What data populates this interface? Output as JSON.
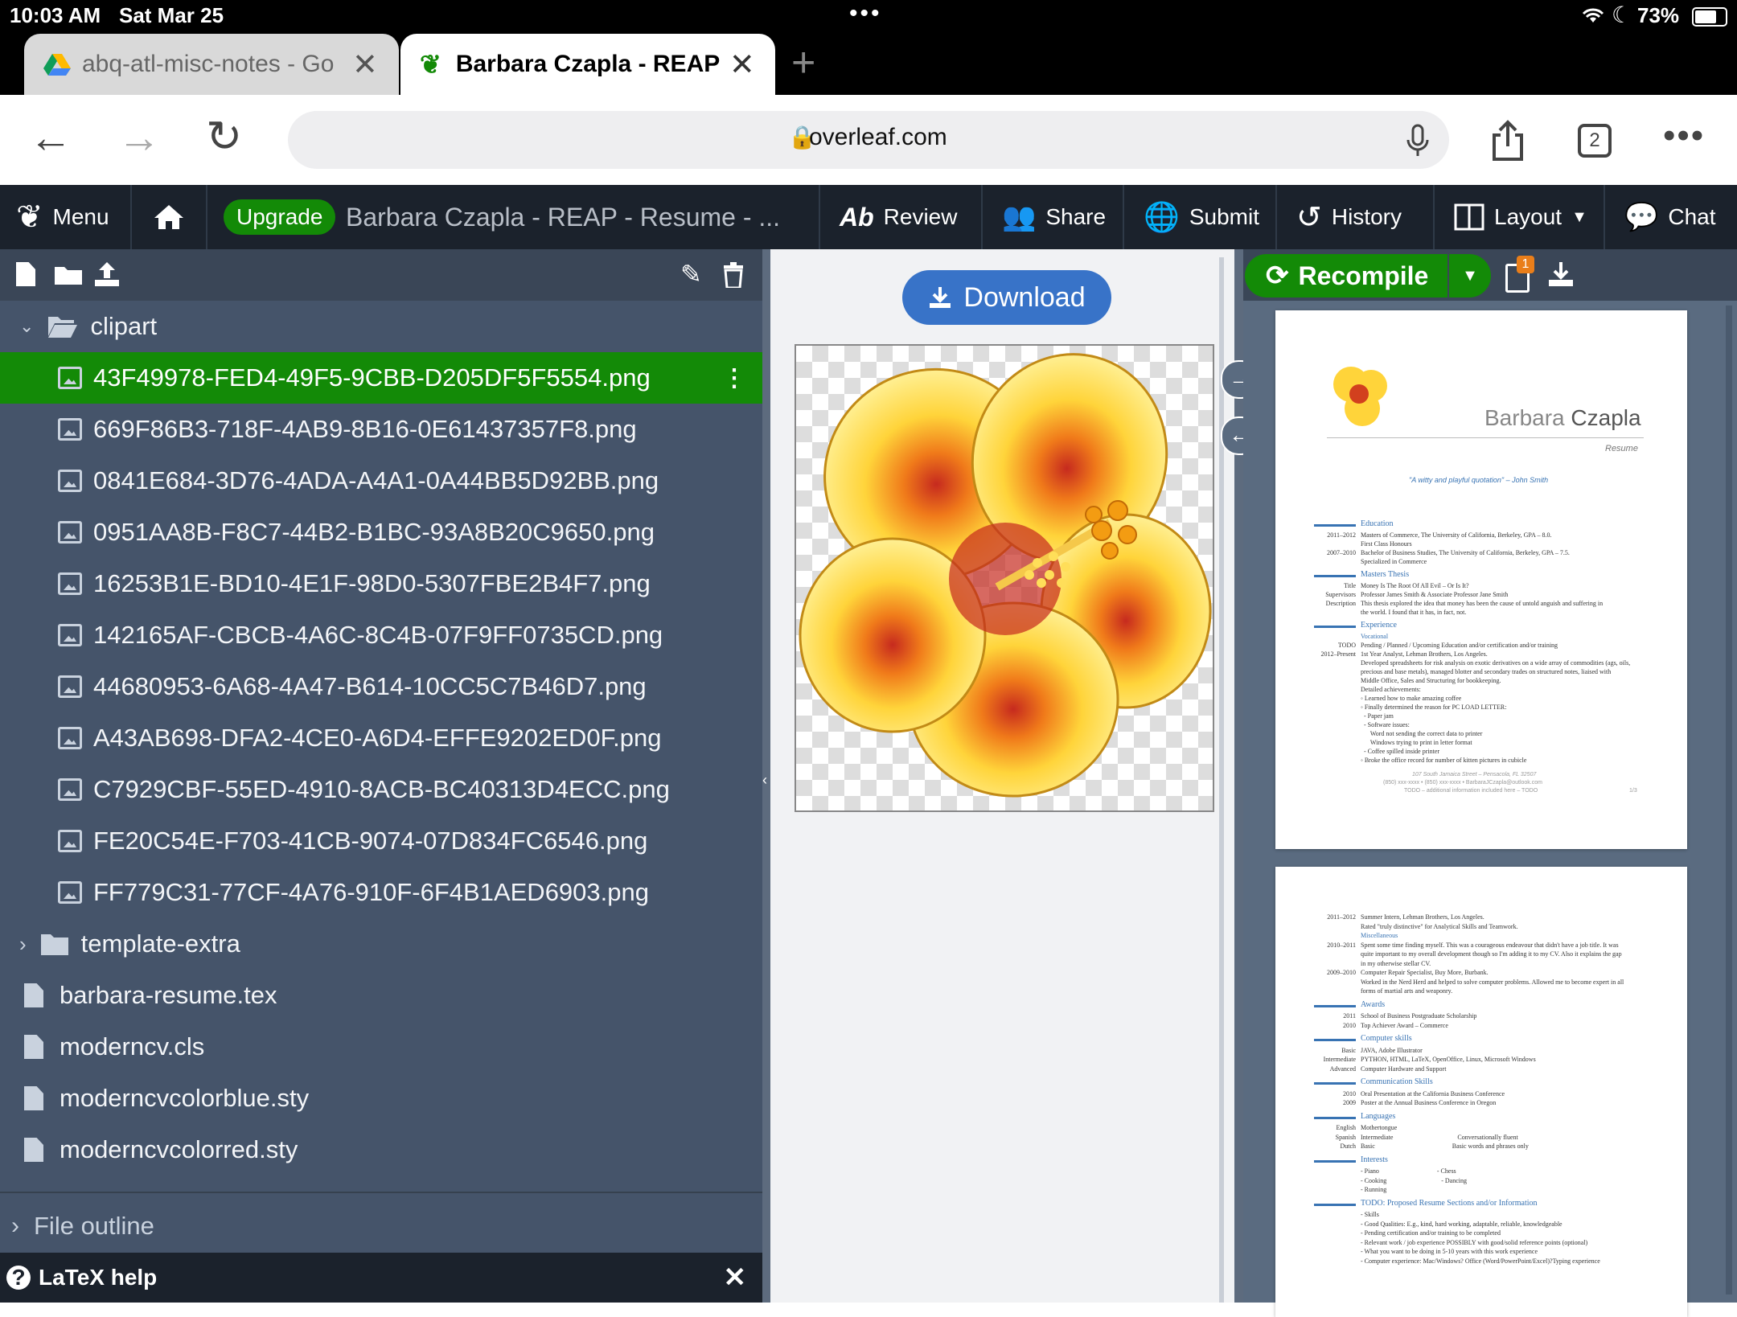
{
  "status": {
    "time": "10:03 AM",
    "date": "Sat Mar 25",
    "battery": "73%"
  },
  "tabs": [
    {
      "title": "abq-atl-misc-notes - Go",
      "icon": "google-drive-icon"
    },
    {
      "title": "Barbara Czapla - REAP - ",
      "icon": "overleaf-icon"
    }
  ],
  "address": {
    "url": "overleaf.com",
    "tab_count": "2"
  },
  "toolbar": {
    "menu": "Menu",
    "upgrade": "Upgrade",
    "project_title": "Barbara Czapla - REAP - Resume - ...",
    "review": "Review",
    "share": "Share",
    "submit": "Submit",
    "history": "History",
    "layout": "Layout",
    "chat": "Chat"
  },
  "filetree": {
    "folder_open": "clipart",
    "clipart_files": [
      "43F49978-FED4-49F5-9CBB-D205DF5F5554.png",
      "669F86B3-718F-4AB9-8B16-0E61437357F8.png",
      "0841E684-3D76-4ADA-A4A1-0A44BB5D92BB.png",
      "0951AA8B-F8C7-44B2-B1BC-93A8B20C9650.png",
      "16253B1E-BD10-4E1F-98D0-5307FBE2B4F7.png",
      "142165AF-CBCB-4A6C-8C4B-07F9FF0735CD.png",
      "44680953-6A68-4A47-B614-10CC5C7B46D7.png",
      "A43AB698-DFA2-4CE0-A6D4-EFFE9202ED0F.png",
      "C7929CBF-55ED-4910-8ACB-BC40313D4ECC.png",
      "FE20C54E-F703-41CB-9074-07D834FC6546.png",
      "FF779C31-77CF-4A76-910F-6F4B1AED6903.png"
    ],
    "folder_closed": "template-extra",
    "root_files": [
      "barbara-resume.tex",
      "moderncv.cls",
      "moderncvcolorblue.sty",
      "moderncvcolorred.sty"
    ],
    "file_outline": "File outline",
    "latex_help": "LaTeX help"
  },
  "preview": {
    "download": "Download"
  },
  "pdf": {
    "recompile": "Recompile",
    "log_badge": "1",
    "name_first": "Barbara",
    "name_last": "Czapla",
    "subtitle": "Resume",
    "quote": "\"A witty and playful quotation\" – John Smith",
    "page1": [
      {
        "type": "h",
        "text": "Education"
      },
      {
        "type": "t",
        "date": "2011–2012",
        "text": "Masters of Commerce, The University of California, Berkeley, GPA – 8.0."
      },
      {
        "type": "t",
        "date": "",
        "text": "First Class Honours"
      },
      {
        "type": "t",
        "date": "2007–2010",
        "text": "Bachelor of Business Studies, The University of California, Berkeley, GPA – 7.5."
      },
      {
        "type": "t",
        "date": "",
        "text": "Specialized in Commerce"
      },
      {
        "type": "h",
        "text": "Masters Thesis"
      },
      {
        "type": "t",
        "date": "Title",
        "text": "Money Is The Root Of All Evil – Or Is It?"
      },
      {
        "type": "t",
        "date": "Supervisors",
        "text": "Professor James Smith & Associate Professor Jane Smith"
      },
      {
        "type": "t",
        "date": "Description",
        "text": "This thesis explored the idea that money has been the cause of untold anguish and suffering in"
      },
      {
        "type": "t",
        "date": "",
        "text": "the world. I found that it has, in fact, not."
      },
      {
        "type": "h",
        "text": "Experience"
      },
      {
        "type": "s",
        "text": "Vocational"
      },
      {
        "type": "t",
        "date": "TODO",
        "text": "Pending / Planned / Upcoming Education and/or certification and/or training"
      },
      {
        "type": "t",
        "date": "2012–Present",
        "text": "1st Year Analyst, Lehman Brothers, Los Angeles."
      },
      {
        "type": "t",
        "date": "",
        "text": "Developed spreadsheets for risk analysis on exotic derivatives on a wide array of commodities (ags, oils,"
      },
      {
        "type": "t",
        "date": "",
        "text": "precious and base metals), managed blotter and secondary trades on structured notes, liaised with"
      },
      {
        "type": "t",
        "date": "",
        "text": "Middle Office, Sales and Structuring for bookkeeping."
      },
      {
        "type": "t",
        "date": "",
        "text": "Detailed achievements:"
      },
      {
        "type": "t",
        "date": "",
        "text": "◦ Learned how to make amazing coffee"
      },
      {
        "type": "t",
        "date": "",
        "text": "◦ Finally determined the reason for PC LOAD LETTER:"
      },
      {
        "type": "t",
        "date": "",
        "text": "  - Paper jam"
      },
      {
        "type": "t",
        "date": "",
        "text": "  - Software issues:"
      },
      {
        "type": "t",
        "date": "",
        "text": "      Word not sending the correct data to printer"
      },
      {
        "type": "t",
        "date": "",
        "text": "      Windows trying to print in letter format"
      },
      {
        "type": "t",
        "date": "",
        "text": "  - Coffee spilled inside printer"
      },
      {
        "type": "t",
        "date": "",
        "text": "◦ Broke the office record for number of kitten pictures in cubicle"
      }
    ],
    "footer1": "107 South Jamaica Street – Pensacola, FL 32507",
    "footer2": "(850) xxx-xxxx  •  (850) xxx-xxxx  •  BarbaraJCzapla@outlook.com",
    "footer3": "TODO – additional information included here – TODO",
    "page_num": "1/3",
    "page2": [
      {
        "type": "t",
        "date": "2011–2012",
        "text": "Summer Intern, Lehman Brothers, Los Angeles."
      },
      {
        "type": "t",
        "date": "",
        "text": "Rated \"truly distinctive\" for Analytical Skills and Teamwork."
      },
      {
        "type": "s",
        "text": "Miscellaneous"
      },
      {
        "type": "t",
        "date": "2010–2011",
        "text": "Spent some time finding myself. This was a courageous endeavour that didn't have a job title. It was"
      },
      {
        "type": "t",
        "date": "",
        "text": "quite important to my overall development though so I'm adding it to my CV. Also it explains the gap"
      },
      {
        "type": "t",
        "date": "",
        "text": "in my otherwise stellar CV."
      },
      {
        "type": "t",
        "date": "2009–2010",
        "text": "Computer Repair Specialist, Buy More, Burbank."
      },
      {
        "type": "t",
        "date": "",
        "text": "Worked in the Nerd Herd and helped to solve computer problems. Allowed me to become expert in all"
      },
      {
        "type": "t",
        "date": "",
        "text": "forms of martial arts and weaponry."
      },
      {
        "type": "h",
        "text": "Awards"
      },
      {
        "type": "t",
        "date": "2011",
        "text": "School of Business Postgraduate Scholarship"
      },
      {
        "type": "t",
        "date": "2010",
        "text": "Top Achiever Award – Commerce"
      },
      {
        "type": "h",
        "text": "Computer skills"
      },
      {
        "type": "t",
        "date": "Basic",
        "text": "JAVA, Adobe Illustrator"
      },
      {
        "type": "t",
        "date": "Intermediate",
        "text": "PYTHON, HTML, LaTeX, OpenOffice, Linux, Microsoft Windows"
      },
      {
        "type": "t",
        "date": "Advanced",
        "text": "Computer Hardware and Support"
      },
      {
        "type": "h",
        "text": "Communication Skills"
      },
      {
        "type": "t",
        "date": "2010",
        "text": "Oral Presentation at the California Business Conference"
      },
      {
        "type": "t",
        "date": "2009",
        "text": "Poster at the Annual Business Conference in Oregon"
      },
      {
        "type": "h",
        "text": "Languages"
      },
      {
        "type": "t",
        "date": "English",
        "text": "Mothertongue"
      },
      {
        "type": "t",
        "date": "Spanish",
        "text": "Intermediate                                        Conversationally fluent"
      },
      {
        "type": "t",
        "date": "Dutch",
        "text": "Basic                                                Basic words and phrases only"
      },
      {
        "type": "h",
        "text": "Interests"
      },
      {
        "type": "t",
        "date": "",
        "text": "- Piano                                    - Chess"
      },
      {
        "type": "t",
        "date": "",
        "text": "- Cooking                                  - Dancing"
      },
      {
        "type": "t",
        "date": "",
        "text": "- Running"
      },
      {
        "type": "h",
        "text": "TODO: Proposed Resume Sections and/or Information"
      },
      {
        "type": "t",
        "date": "",
        "text": "- Skills"
      },
      {
        "type": "t",
        "date": "",
        "text": "- Good Qualities: E.g., kind, hard working, adaptable, reliable, knowledgeable"
      },
      {
        "type": "t",
        "date": "",
        "text": "- Pending certification and/or training to be completed"
      },
      {
        "type": "t",
        "date": "",
        "text": "- Relevant work / job experience POSSIBLY with good/solid reference points (optional)"
      },
      {
        "type": "t",
        "date": "",
        "text": "- What you want to be doing in 5-10 years with this work experience"
      },
      {
        "type": "t",
        "date": "",
        "text": "- Computer experience: Mac/Windows? Office (Word/PowerPoint/Excel)?Typing experience"
      }
    ]
  },
  "colors": {
    "accent_green": "#138a07",
    "overleaf_dark": "#1b222c",
    "filetree_bg": "#45546a",
    "download_blue": "#3873c8",
    "cv_blue": "#3873b3"
  }
}
